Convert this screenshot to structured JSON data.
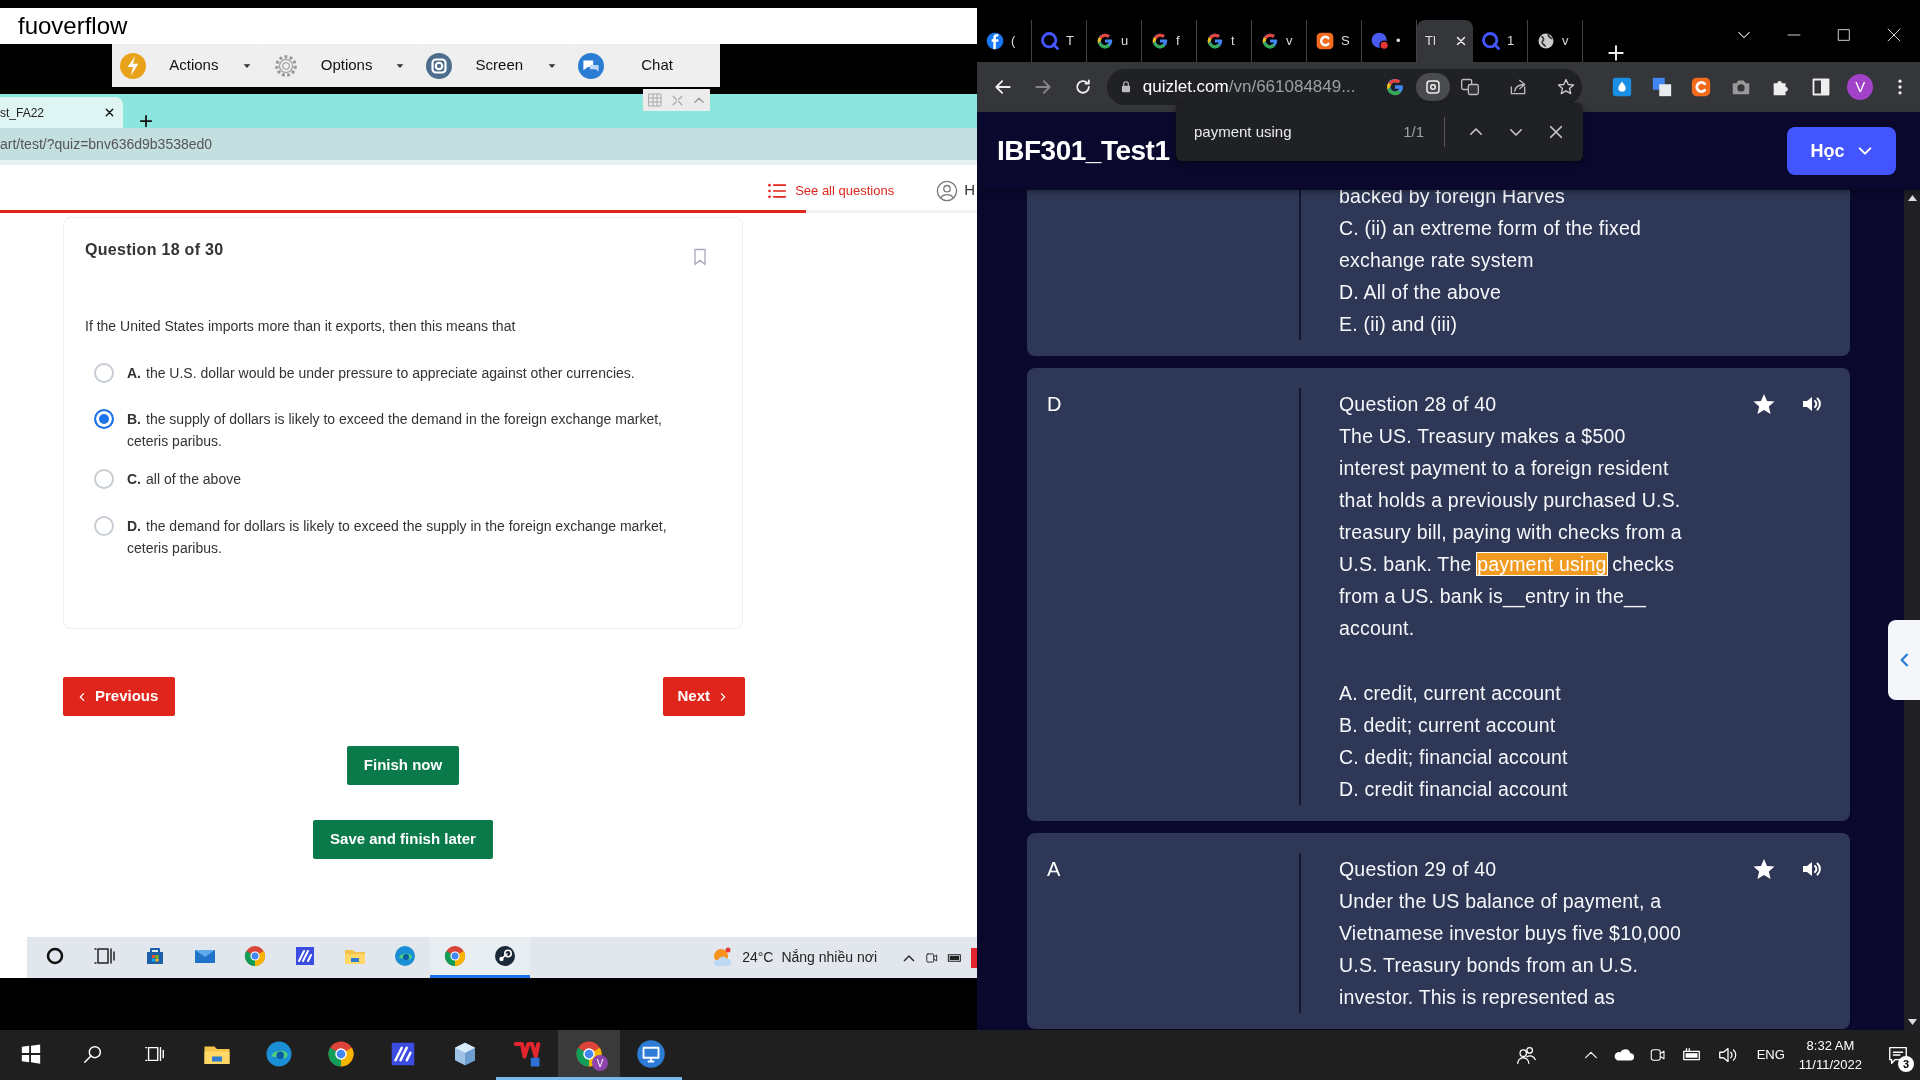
{
  "remote": {
    "title": "fuoverflow",
    "menu": [
      {
        "label": "Actions",
        "dropdown": true
      },
      {
        "label": "Options",
        "dropdown": true
      },
      {
        "label": "Screen",
        "dropdown": true
      },
      {
        "label": "Chat",
        "dropdown": false
      }
    ]
  },
  "left_browser": {
    "tab": {
      "title": "st_FA22"
    },
    "url": "art/test/?quiz=bnv636d9b3538ed0"
  },
  "quiz": {
    "see_all": "See all questions",
    "account_label": "H",
    "progress": {
      "level": 0.825
    },
    "title": "Question 18 of 30",
    "prompt": "If the United States imports more than it exports, then this means that",
    "options": [
      {
        "letter": "A.",
        "text": "the U.S. dollar would be under pressure to appreciate against other currencies.",
        "selected": false
      },
      {
        "letter": "B.",
        "text": "the supply of dollars is likely to exceed the demand in the foreign exchange market, ceteris paribus.",
        "selected": true
      },
      {
        "letter": "C.",
        "text": "all of the above",
        "selected": false
      },
      {
        "letter": "D.",
        "text": "the demand for dollars is likely to exceed the supply in the foreign exchange market, ceteris paribus.",
        "selected": false
      }
    ],
    "previous": "Previous",
    "next": "Next",
    "finish": "Finish now",
    "save": "Save and finish later"
  },
  "remote_taskbar": {
    "apps": [
      {
        "running": false
      },
      {
        "running": false
      },
      {
        "running": false
      },
      {
        "running": false
      },
      {
        "running": false
      },
      {
        "running": false
      },
      {
        "running": false
      },
      {
        "running": false
      },
      {
        "running": true
      },
      {
        "running": true
      }
    ],
    "temperature": "24°C",
    "weather": "Nắng nhiều nơi"
  },
  "chrome": {
    "tabs": [
      {
        "title": "(",
        "selected": false
      },
      {
        "title": "T",
        "selected": false
      },
      {
        "title": "u",
        "selected": false
      },
      {
        "title": "f",
        "selected": false
      },
      {
        "title": "t",
        "selected": false
      },
      {
        "title": "v",
        "selected": false
      },
      {
        "title": "S",
        "selected": false
      },
      {
        "title": "•",
        "selected": false
      },
      {
        "title": "Tl",
        "selected": true
      },
      {
        "title": "1",
        "selected": false
      },
      {
        "title": "v",
        "selected": false
      }
    ],
    "url_host": "quizlet.com",
    "url_path": "/vn/661084849...",
    "profile": "V",
    "find": {
      "query": "payment using",
      "count": "1/1"
    }
  },
  "quizlet": {
    "title": "IBF301_Test1",
    "menu_button": "Học",
    "cards": [
      {
        "lines": [
          "backed by foreign Harves",
          "C. (ii) an extreme form of the fixed exchange rate system",
          "D. All of the above",
          "E. (ii) and (iii)"
        ]
      },
      {
        "term": "D",
        "title": "Question 28 of 40",
        "text": [
          {
            "text": "The US. Treasury makes a $500 interest payment to a foreign resident that holds a previously purchased U.S. treasury bill, paying with checks from a U.S. bank. The ",
            "match": false
          },
          {
            "text": "payment using",
            "match": true
          },
          {
            "text": " checks from a US. bank is__entry in the__ account.",
            "match": false
          }
        ],
        "lines": [
          "A. credit, current account",
          "B. dedit; current account",
          "C. dedit; financial account",
          "D. credit financial account"
        ]
      },
      {
        "term": "A",
        "title": "Question 29 of 40",
        "text": [
          {
            "text": "Under the US balance of payment, a Vietnamese investor buys five $10,000 U.S. Treasury bonds from an U.S. investor. This is represented as",
            "match": false
          }
        ]
      }
    ]
  },
  "taskbar": {
    "apps": [
      {
        "running": false,
        "selected": false
      },
      {
        "running": false,
        "selected": false
      },
      {
        "running": false,
        "selected": false
      },
      {
        "running": false,
        "selected": false
      },
      {
        "running": false,
        "selected": false
      },
      {
        "running": true,
        "selected": false
      },
      {
        "running": true,
        "selected": true,
        "badge": "V"
      },
      {
        "running": true,
        "selected": false
      }
    ],
    "language": "ENG",
    "time": "8:32 AM",
    "date": "11/11/2022",
    "notifications": "3"
  }
}
